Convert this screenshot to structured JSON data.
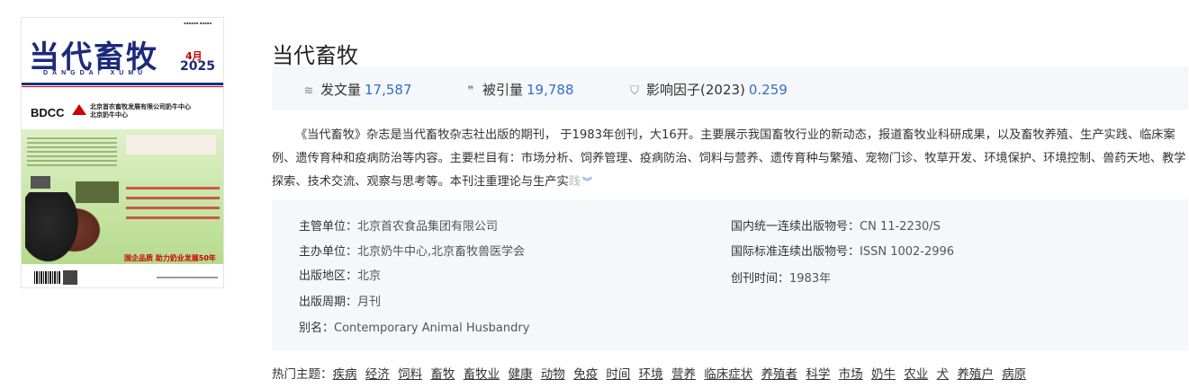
{
  "cover": {
    "logo_text": "当代畜牧",
    "pinyin": "DANGDAI XUMU",
    "month": "4月",
    "year": "2025",
    "sponsor_brand": "BDCC",
    "sponsor_line1": "北京首农畜牧发展有限公司奶牛中心",
    "sponsor_line2": "北京奶牛中心",
    "slogan": "国企品质 助力奶业发展50年"
  },
  "page": {
    "title": "当代畜牧"
  },
  "stats": [
    {
      "icon": "layers-icon",
      "label": "发文量",
      "value": "17,587"
    },
    {
      "icon": "quote-icon",
      "label": "被引量",
      "value": "19,788"
    },
    {
      "icon": "shield-icon",
      "label": "影响因子(2023)",
      "value": "0.259"
    }
  ],
  "description": {
    "text": "《当代畜牧》杂志是当代畜牧杂志社出版的期刊， 于1983年创刊，大16开。主要展示我国畜牧行业的新动态，报道畜牧业科研成果，以及畜牧养殖、生产实践、临床案例、遗传育种和疫病防治等内容。主要栏目有：市场分析、饲养管理、疫病防治、饲料与营养、遗传育种与繁殖、宠物门诊、牧草开发、环境保护、环境控制、兽药天地、教学探索、技术交流、观察与思考等。本刊注重理论与生产实",
    "fade_text": "践",
    "expand_icon": "chevron-double-down-icon"
  },
  "info": {
    "supervisor_label": "主管单位：",
    "supervisor": "北京首农食品集团有限公司",
    "sponsor_label": "主办单位：",
    "sponsor": "北京奶牛中心,北京畜牧兽医学会",
    "region_label": "出版地区：",
    "region": "北京",
    "period_label": "出版周期：",
    "period": "月刊",
    "alias_label": "别名：",
    "alias": "Contemporary Animal Husbandry",
    "cn_label": "国内统一连续出版物号：",
    "cn": "CN 11-2230/S",
    "issn_label": "国际标准连续出版物号：",
    "issn": "ISSN 1002-2996",
    "founded_label": "创刊时间：",
    "founded": "1983年"
  },
  "topics": {
    "label": "热门主题：",
    "items": [
      "疾病",
      "经济",
      "饲料",
      "畜牧",
      "畜牧业",
      "健康",
      "动物",
      "免疫",
      "时间",
      "环境",
      "营养",
      "临床症状",
      "养殖者",
      "科学",
      "市场",
      "奶牛",
      "农业",
      "犬",
      "养殖户",
      "病原"
    ]
  }
}
